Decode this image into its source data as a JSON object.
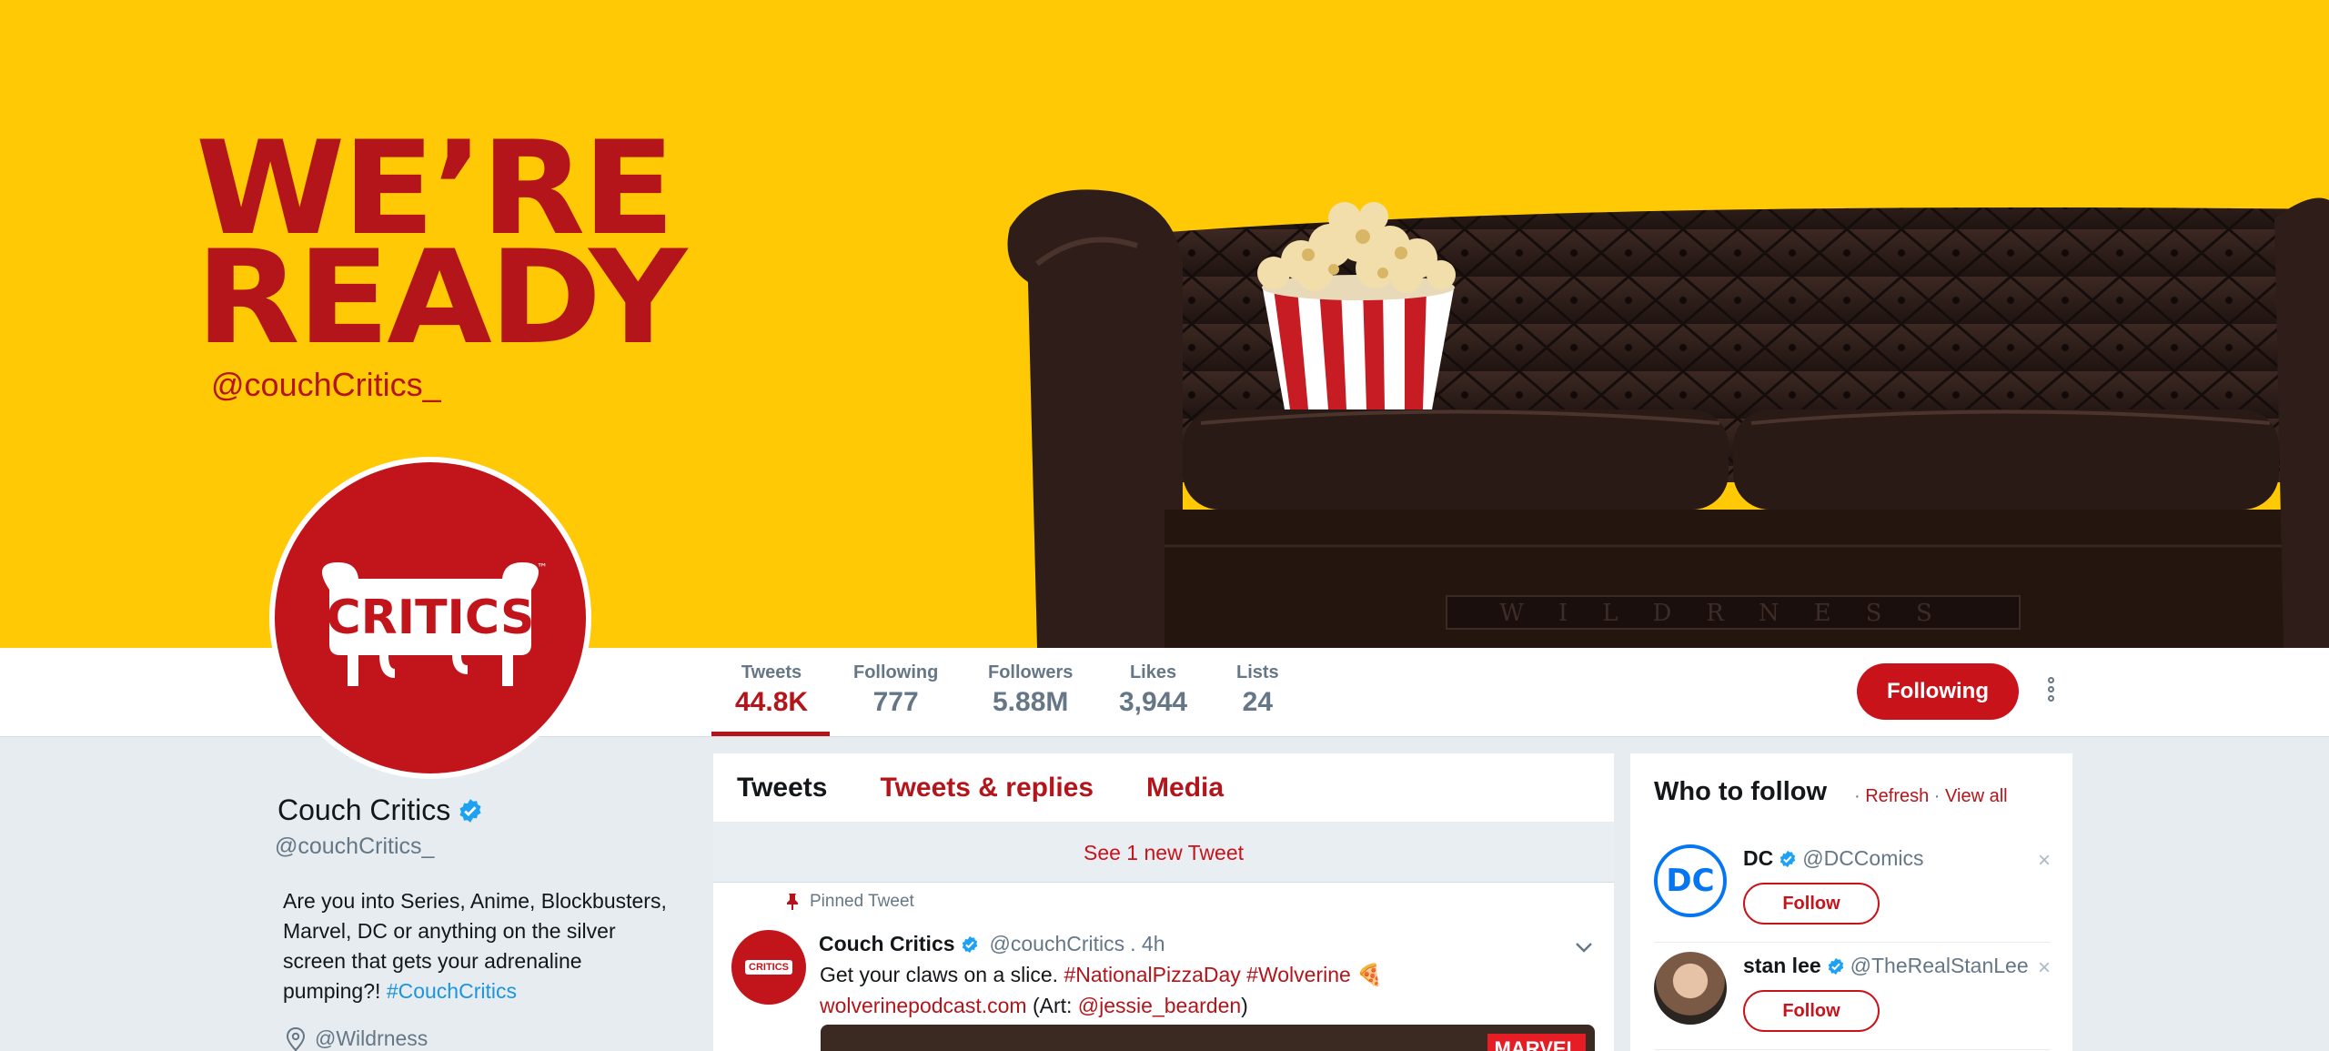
{
  "banner": {
    "slogan_line1": "WE’RE",
    "slogan_line2": "READY",
    "handle": "@couchCritics_",
    "sofa_plaque": "WILDRNESS"
  },
  "avatar": {
    "logo_text": "CRITICS",
    "tm": "™"
  },
  "nav": {
    "stats": [
      {
        "label": "Tweets",
        "value": "44.8K"
      },
      {
        "label": "Following",
        "value": "777"
      },
      {
        "label": "Followers",
        "value": "5.88M"
      },
      {
        "label": "Likes",
        "value": "3,944"
      },
      {
        "label": "Lists",
        "value": "24"
      }
    ],
    "following_button": "Following"
  },
  "profile": {
    "name": "Couch Critics",
    "handle": "@couchCritics_",
    "bio_text": "Are you into Series, Anime, Blockbusters, Marvel, DC or anything on the silver screen that gets your adrenaline pumping?! ",
    "bio_hashtag": "#CouchCritics",
    "location": "@Wildrness"
  },
  "timeline": {
    "tabs": [
      "Tweets",
      "Tweets & replies",
      "Media"
    ],
    "new_tweet_banner": "See 1 new Tweet",
    "pinned_label": "Pinned Tweet",
    "tweet": {
      "avatar_badge": "CRITICS",
      "name": "Couch Critics",
      "handle": "@couchCritics",
      "time": ". 4h",
      "text_start": "Get your claws on a slice. ",
      "hashtag1": "#NationalPizzaDay",
      "hashtag2": "#Wolverine",
      "emoji": "🍕",
      "link": "wolverinepodcast.com",
      "art_prefix": " (Art: ",
      "art_handle": "@jessie_bearden",
      "art_suffix": ")",
      "media_badge": "MARVEL"
    }
  },
  "who_to_follow": {
    "title": "Who to follow",
    "refresh": "Refresh",
    "view_all": "View all",
    "separator": " · ",
    "items": [
      {
        "name": "DC",
        "handle": "@DCComics",
        "button": "Follow",
        "avatar_text": "DC"
      },
      {
        "name": "stan lee",
        "handle": "@TheRealStanLee",
        "button": "Follow"
      }
    ],
    "close": "×"
  },
  "colors": {
    "brand_red": "#c8131b",
    "banner_yellow": "#ffc906",
    "verified_blue": "#1da1f2"
  }
}
